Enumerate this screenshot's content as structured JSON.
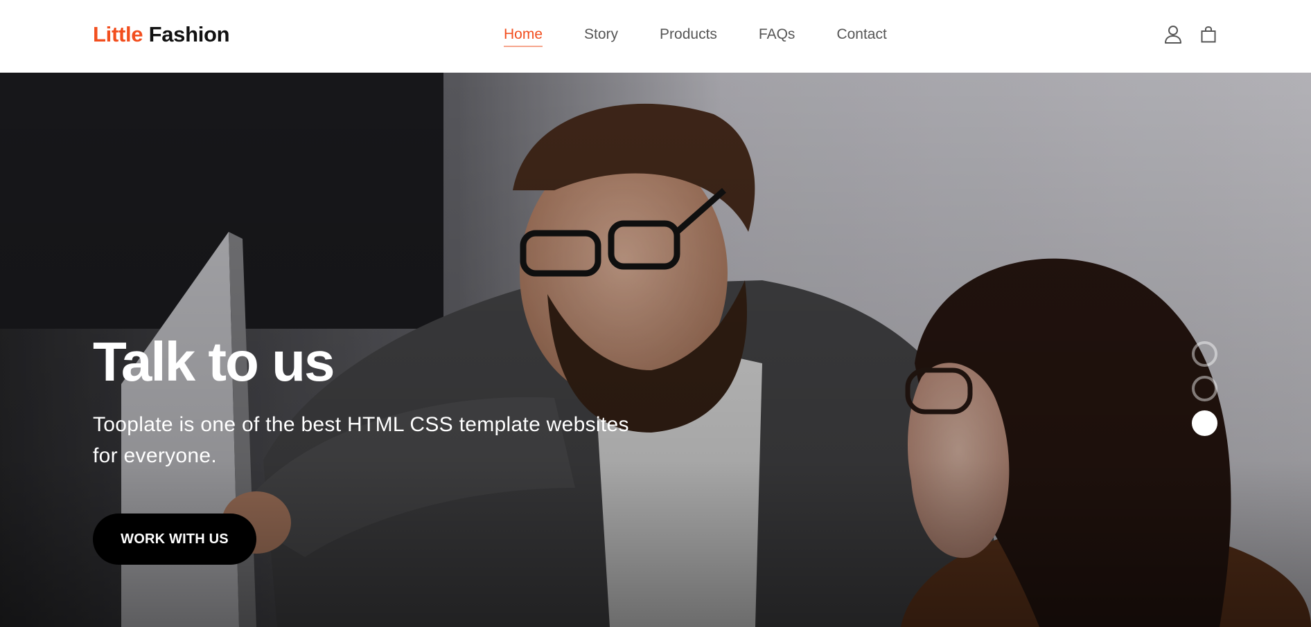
{
  "brand": {
    "part1": "Little",
    "part2": "Fashion",
    "accent_color": "#f24e1e"
  },
  "nav": {
    "items": [
      {
        "label": "Home",
        "active": true
      },
      {
        "label": "Story",
        "active": false
      },
      {
        "label": "Products",
        "active": false
      },
      {
        "label": "FAQs",
        "active": false
      },
      {
        "label": "Contact",
        "active": false
      }
    ]
  },
  "header_icons": {
    "account": "user-icon",
    "cart": "shopping-bag-icon"
  },
  "hero": {
    "image": "two-people-looking-at-screen-photo",
    "title": "Talk to us",
    "text": "Tooplate is one of the best HTML CSS template websites for everyone.",
    "cta_label": "WORK WITH US",
    "slides": {
      "count": 3,
      "active_index": 2
    }
  }
}
